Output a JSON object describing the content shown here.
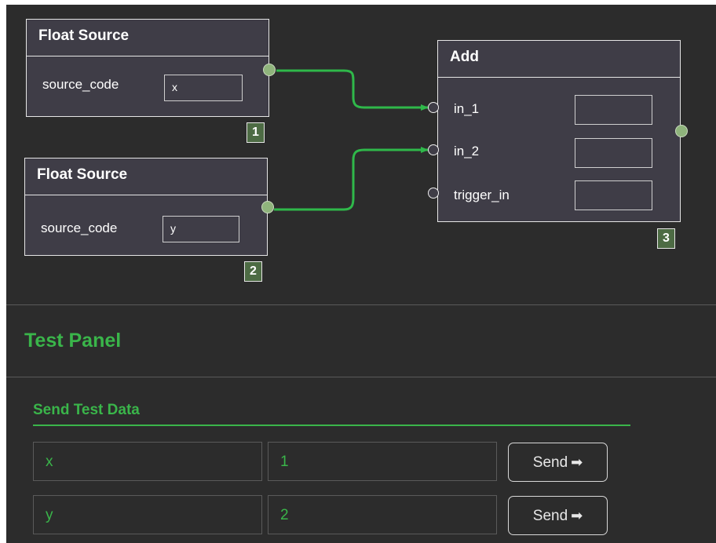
{
  "nodes": [
    {
      "id": "1",
      "title": "Float Source",
      "param_label": "source_code",
      "param_value": "x"
    },
    {
      "id": "2",
      "title": "Float Source",
      "param_label": "source_code",
      "param_value": "y"
    },
    {
      "id": "3",
      "title": "Add",
      "inputs": [
        "in_1",
        "in_2",
        "trigger_in"
      ]
    }
  ],
  "test_panel": {
    "title": "Test Panel",
    "section_title": "Send Test Data",
    "rows": [
      {
        "key": "x",
        "value": "1",
        "button": "Send"
      },
      {
        "key": "y",
        "value": "2",
        "button": "Send"
      }
    ],
    "arrow_glyph": "➡"
  },
  "colors": {
    "background": "#2c2c2c",
    "node_fill": "#3f3d47",
    "accent_green": "#3ab54a",
    "node_id_badge": "#4d6b44",
    "output_port": "#8fb47c"
  }
}
